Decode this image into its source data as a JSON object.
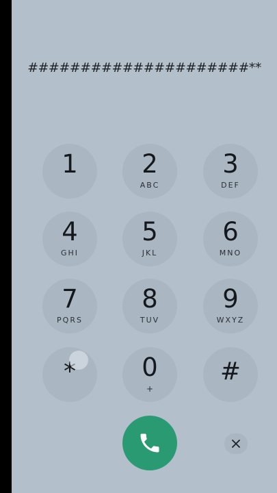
{
  "dialer": {
    "display_value": "#####################**",
    "keys": [
      {
        "digit": "1",
        "letters": ""
      },
      {
        "digit": "2",
        "letters": "ABC"
      },
      {
        "digit": "3",
        "letters": "DEF"
      },
      {
        "digit": "4",
        "letters": "GHI"
      },
      {
        "digit": "5",
        "letters": "JKL"
      },
      {
        "digit": "6",
        "letters": "MNO"
      },
      {
        "digit": "7",
        "letters": "PQRS"
      },
      {
        "digit": "8",
        "letters": "TUV"
      },
      {
        "digit": "9",
        "letters": "WXYZ"
      },
      {
        "digit": "*",
        "letters": ""
      },
      {
        "digit": "0",
        "letters": "+"
      },
      {
        "digit": "#",
        "letters": ""
      }
    ],
    "call_icon": "phone-icon",
    "delete_icon": "close-icon"
  },
  "colors": {
    "background": "#b3bfca",
    "key_background": "#aab6c1",
    "call_button": "#2a9a72",
    "text": "#15191d"
  }
}
